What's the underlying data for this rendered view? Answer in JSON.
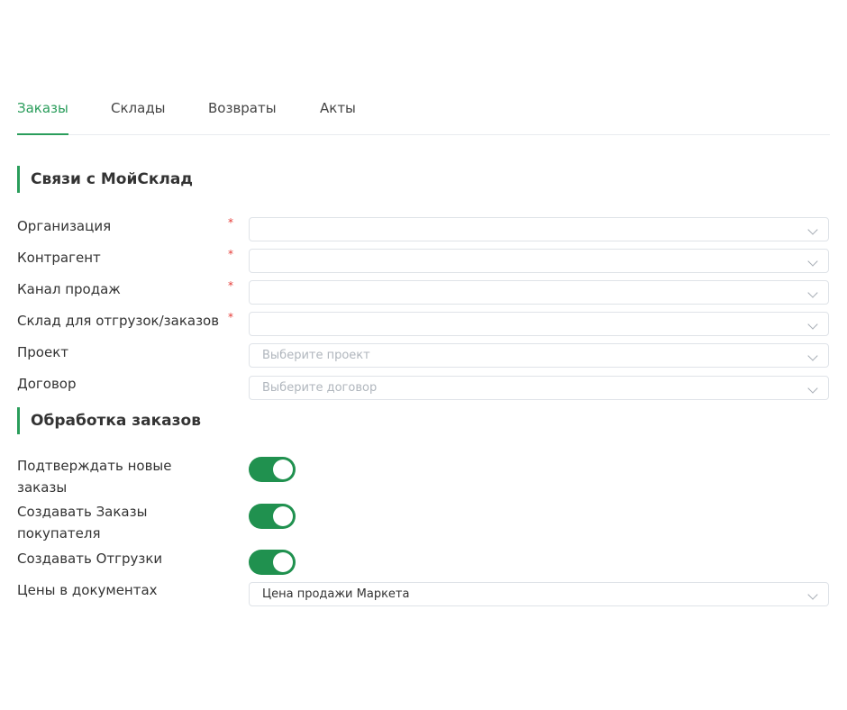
{
  "tabs": [
    {
      "label": "Заказы",
      "active": true
    },
    {
      "label": "Склады",
      "active": false
    },
    {
      "label": "Возвраты",
      "active": false
    },
    {
      "label": "Акты",
      "active": false
    }
  ],
  "sections": {
    "links_title": "Связи с МойСклад",
    "processing_title": "Обработка заказов"
  },
  "links_form": {
    "organization": {
      "label": "Организация",
      "required": "*",
      "value": ""
    },
    "counterparty": {
      "label": "Контрагент",
      "required": "*",
      "value": ""
    },
    "sales_channel": {
      "label": "Канал продаж",
      "required": "*",
      "value": ""
    },
    "warehouse": {
      "label": "Склад для отгрузок/заказов",
      "required": "*",
      "value": ""
    },
    "project": {
      "label": "Проект",
      "placeholder": "Выберите проект"
    },
    "contract": {
      "label": "Договор",
      "placeholder": "Выберите договор"
    }
  },
  "processing_form": {
    "confirm_new_orders": {
      "label": "Подтверждать новые заказы",
      "enabled": true
    },
    "create_customer_orders": {
      "label": "Создавать Заказы покупателя",
      "enabled": true
    },
    "create_shipments": {
      "label": "Создавать Отгрузки",
      "enabled": true
    },
    "prices_in_documents": {
      "label": "Цены в документах",
      "value": "Цена продажи Маркета"
    }
  },
  "colors": {
    "accent": "#2a9d5b",
    "toggle_on": "#20914f",
    "required": "#e53935"
  },
  "icons": {
    "select_arrow": "chevron-down-icon"
  }
}
